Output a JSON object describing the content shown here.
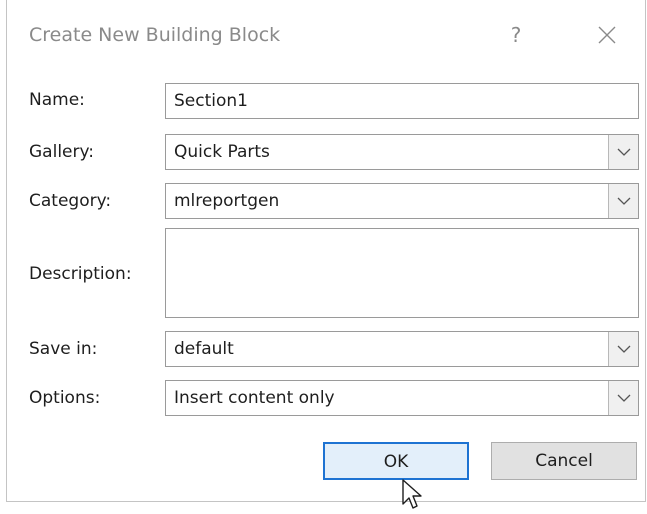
{
  "dialog": {
    "title": "Create New Building Block",
    "help_label": "?"
  },
  "fields": {
    "name_label": "Name:",
    "name_value": "Section1",
    "gallery_label": "Gallery:",
    "gallery_value": "Quick Parts",
    "category_label": "Category:",
    "category_value": "mlreportgen",
    "description_label": "Description:",
    "description_value": "",
    "save_in_label": "Save in:",
    "save_in_value": "default",
    "options_label": "Options:",
    "options_value": "Insert content only"
  },
  "buttons": {
    "ok_label": "OK",
    "cancel_label": "Cancel"
  },
  "icons": {
    "close": "close-icon",
    "dropdown": "chevron-down-icon",
    "cursor": "mouse-pointer-icon"
  },
  "colors": {
    "accent": "#1e73d2",
    "title_text": "#8a8a8a"
  }
}
